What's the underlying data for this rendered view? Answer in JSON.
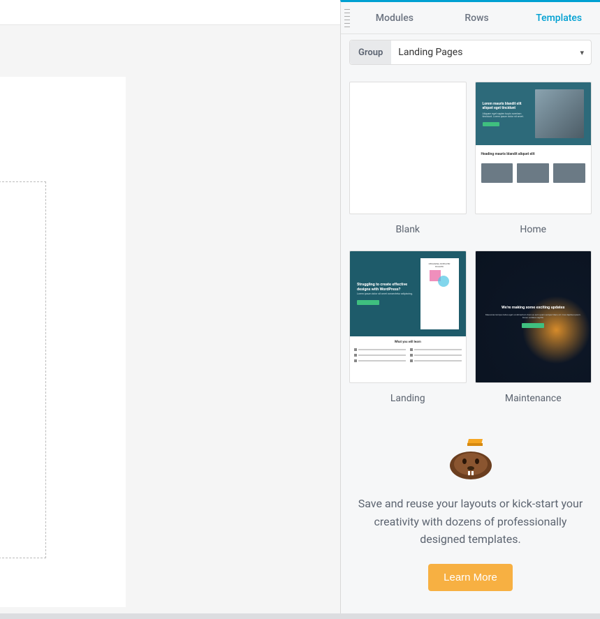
{
  "tabs": {
    "modules": "Modules",
    "rows": "Rows",
    "templates": "Templates"
  },
  "group": {
    "label": "Group",
    "selected": "Landing Pages"
  },
  "drop_hint": "!",
  "templates": [
    {
      "key": "blank",
      "label": "Blank"
    },
    {
      "key": "home",
      "label": "Home"
    },
    {
      "key": "landing",
      "label": "Landing"
    },
    {
      "key": "maintenance",
      "label": "Maintenance"
    }
  ],
  "thumb_text": {
    "home_heading": "Lorem mauris blandit elit aliquet eget tincidunt",
    "home_sub_heading": "Heading mauris blandit aliquet elit",
    "landing_heading": "Struggling to create effective designs with WordPress?",
    "landing_book_title": "DESIGNING IN BEAVER BUILDER",
    "landing_learn": "What you will learn",
    "maintenance_heading": "We're making some exciting updates"
  },
  "promo": {
    "text": "Save and reuse your layouts or kick-start your creativity with dozens of professionally designed templates.",
    "button": "Learn More"
  }
}
